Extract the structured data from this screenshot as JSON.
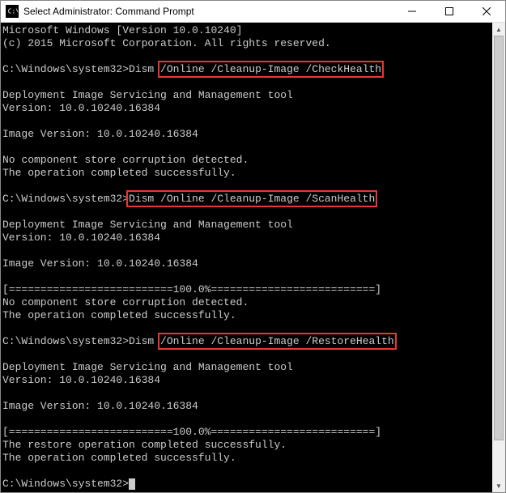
{
  "titlebar": {
    "title": "Select Administrator: Command Prompt"
  },
  "terminal": {
    "line_winver": "Microsoft Windows [Version 10.0.10240]",
    "line_copyright": "(c) 2015 Microsoft Corporation. All rights reserved.",
    "prompt1_prefix": "C:\\Windows\\system32>Dism ",
    "cmd1_highlight": "/Online /Cleanup-Image /CheckHealth",
    "dism_tool": "Deployment Image Servicing and Management tool",
    "dism_ver": "Version: 10.0.10240.16384",
    "img_ver": "Image Version: 10.0.10240.16384",
    "no_corrupt": "No component store corruption detected.",
    "op_success": "The operation completed successfully.",
    "prompt2_prefix": "C:\\Windows\\system32>",
    "cmd2_highlight": "Dism /Online /Cleanup-Image /ScanHealth",
    "progress": "[==========================100.0%==========================]",
    "prompt3_prefix": "C:\\Windows\\system32>Dism ",
    "cmd3_highlight": "/Online /Cleanup-Image /RestoreHealth",
    "restore_success": "The restore operation completed successfully.",
    "prompt_final": "C:\\Windows\\system32>"
  }
}
